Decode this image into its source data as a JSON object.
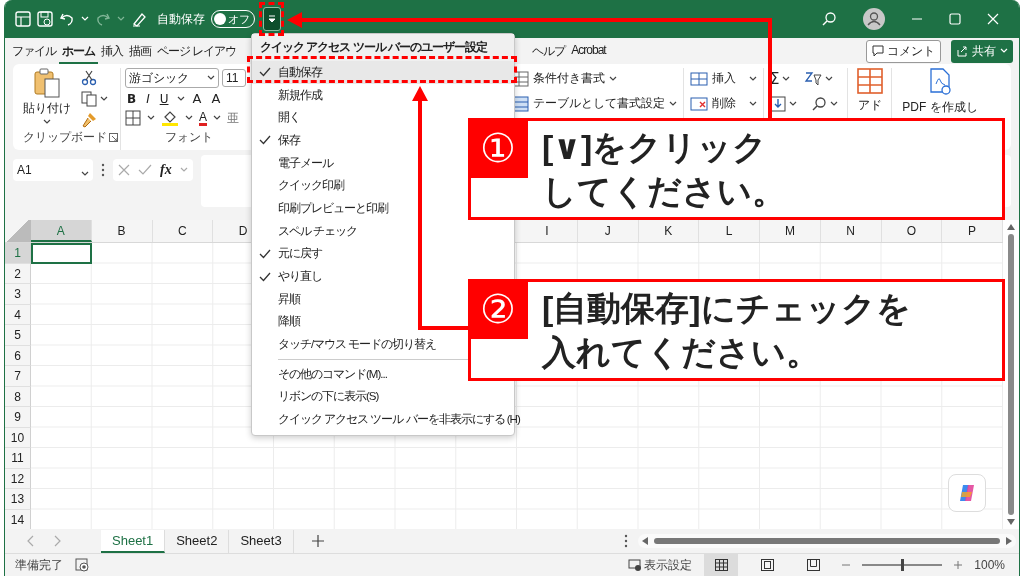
{
  "title_bar": {
    "autosave_label": "自動保存",
    "autosave_toggle": {
      "label": "オフ",
      "on": false
    },
    "qat_dropdown": {
      "selected": true
    }
  },
  "ribbon_tabs_left": [
    {
      "label": "ファイル",
      "selected": false
    },
    {
      "label": "ホーム",
      "selected": true
    },
    {
      "label": "挿入",
      "selected": false
    },
    {
      "label": "描画",
      "selected": false
    },
    {
      "label": "ページ レイアウ",
      "selected": false
    }
  ],
  "ribbon_tabs_right": [
    {
      "label": "ヘルプ",
      "selected": false
    },
    {
      "label": "Acrobat",
      "selected": false
    }
  ],
  "comment_button": "コメント",
  "share_button": "共有",
  "ribbon": {
    "paste_label": "貼り付け",
    "clipboard_group": "クリップボード",
    "font_name": "游ゴシック",
    "font_size": "11",
    "style_buttons": [
      "B",
      "I",
      "U"
    ],
    "size_buttons": [
      "A",
      "A"
    ],
    "font_color_label": "A",
    "phonetic_label": "亜",
    "font_group": "フォント",
    "styles_items": [
      "条件付き書式",
      "テーブルとして書式設定"
    ],
    "cells_items": [
      "挿入",
      "削除"
    ],
    "sum_label": "Σ",
    "addin_label": "アド",
    "acrobat_label": "PDF を作成し"
  },
  "formula_bar": {
    "name_box": "A1",
    "fx_label": "fx"
  },
  "sheet": {
    "columns_left": [
      {
        "label": "A",
        "selected": true
      },
      {
        "label": "B",
        "selected": false
      },
      {
        "label": "C",
        "selected": false
      },
      {
        "label": "D",
        "selected": false
      }
    ],
    "columns_right": [
      {
        "label": "I",
        "selected": false
      },
      {
        "label": "J",
        "selected": false
      },
      {
        "label": "K",
        "selected": false
      },
      {
        "label": "L",
        "selected": false
      },
      {
        "label": "M",
        "selected": false
      },
      {
        "label": "N",
        "selected": false
      },
      {
        "label": "O",
        "selected": false
      },
      {
        "label": "P",
        "selected": false
      }
    ],
    "rows": [
      {
        "label": "1",
        "selected": true
      },
      {
        "label": "2",
        "selected": false
      },
      {
        "label": "3",
        "selected": false
      },
      {
        "label": "4",
        "selected": false
      },
      {
        "label": "5",
        "selected": false
      },
      {
        "label": "6",
        "selected": false
      },
      {
        "label": "7",
        "selected": false
      },
      {
        "label": "8",
        "selected": false
      },
      {
        "label": "9",
        "selected": false
      },
      {
        "label": "10",
        "selected": false
      },
      {
        "label": "11",
        "selected": false
      },
      {
        "label": "12",
        "selected": false
      },
      {
        "label": "13",
        "selected": false
      },
      {
        "label": "14",
        "selected": false
      }
    ]
  },
  "qat_menu": {
    "title": "クイック アクセス ツール バーのユーザー設定",
    "items": [
      {
        "label": "自動保存",
        "checked": true,
        "selected": true
      },
      {
        "label": "新規作成",
        "checked": false,
        "selected": false
      },
      {
        "label": "開く",
        "checked": false,
        "selected": false
      },
      {
        "label": "保存",
        "checked": true,
        "selected": false
      },
      {
        "label": "電子メール",
        "checked": false,
        "selected": false
      },
      {
        "label": "クイック印刷",
        "checked": false,
        "selected": false
      },
      {
        "label": "印刷プレビューと印刷",
        "checked": false,
        "selected": false
      },
      {
        "label": "スペル チェック",
        "checked": false,
        "selected": false
      },
      {
        "label": "元に戻す",
        "checked": true,
        "selected": false
      },
      {
        "label": "やり直し",
        "checked": true,
        "selected": false
      },
      {
        "label": "昇順",
        "checked": false,
        "selected": false
      },
      {
        "label": "降順",
        "checked": false,
        "selected": false
      },
      {
        "label": "タッチ/マウス モードの切り替え",
        "checked": false,
        "selected": false
      }
    ],
    "commands": [
      "その他のコマンド(M)...",
      "リボンの下に表示(S)",
      "クイック アクセス ツール バーを非表示にする (H)"
    ]
  },
  "callouts": [
    {
      "number": "①",
      "lines": [
        "[∨]をクリック",
        "してください。"
      ]
    },
    {
      "number": "②",
      "lines": [
        "[自動保存]にチェックを",
        "入れてください。"
      ]
    }
  ],
  "sheet_tabs": [
    {
      "label": "Sheet1",
      "selected": true
    },
    {
      "label": "Sheet2",
      "selected": false
    },
    {
      "label": "Sheet3",
      "selected": false
    }
  ],
  "status_bar": {
    "status": "準備完了",
    "display_settings": "表示設定",
    "zoom_slider": {
      "level": 0.5
    },
    "zoom": "100%"
  }
}
